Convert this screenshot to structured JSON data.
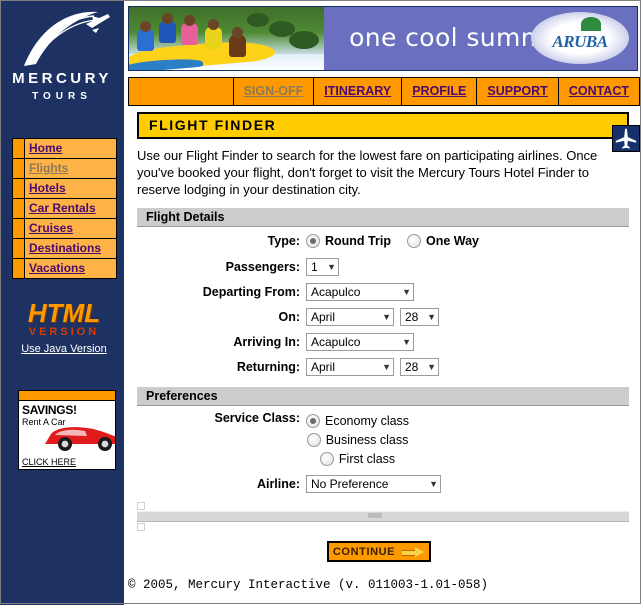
{
  "brand": {
    "name_line1": "MERCURY",
    "name_line2": "TOURS",
    "logo_icon": "airplane-swoosh-icon"
  },
  "banner": {
    "tagline": "one cool summer",
    "sponsor": "ARUBA",
    "photo_alt": "banana-boat-riders-photo"
  },
  "topnav": {
    "items": [
      {
        "label": "SIGN-OFF",
        "disabled": true
      },
      {
        "label": "ITINERARY",
        "disabled": false
      },
      {
        "label": "PROFILE",
        "disabled": false
      },
      {
        "label": "SUPPORT",
        "disabled": false
      },
      {
        "label": "CONTACT",
        "disabled": false
      }
    ]
  },
  "sidebar": {
    "items": [
      {
        "label": "Home",
        "disabled": false
      },
      {
        "label": "Flights",
        "disabled": true
      },
      {
        "label": "Hotels",
        "disabled": false
      },
      {
        "label": "Car Rentals",
        "disabled": false
      },
      {
        "label": "Cruises",
        "disabled": false
      },
      {
        "label": "Destinations",
        "disabled": false
      },
      {
        "label": "Vacations",
        "disabled": false
      }
    ],
    "html_version": {
      "line1": "HTML",
      "line2": "VERSION",
      "java_link": "Use Java Version"
    },
    "savings_ad": {
      "title": "SAVINGS!",
      "subtitle": "Rent A Car",
      "cta": "CLICK HERE"
    }
  },
  "main": {
    "title": "FLIGHT FINDER",
    "plane_icon": "airplane-icon",
    "intro": "Use our Flight Finder to search for the lowest fare on participating airlines. Once you've booked your flight, don't forget to visit the Mercury Tours Hotel Finder to reserve lodging in your destination city.",
    "flight_details": {
      "section_label": "Flight Details",
      "type_label": "Type:",
      "type_options": [
        {
          "label": "Round Trip",
          "selected": true
        },
        {
          "label": "One Way",
          "selected": false
        }
      ],
      "passengers_label": "Passengers:",
      "passengers_value": "1",
      "departing_label": "Departing From:",
      "departing_value": "Acapulco",
      "on_label": "On:",
      "on_month": "April",
      "on_day": "28",
      "arriving_label": "Arriving In:",
      "arriving_value": "Acapulco",
      "returning_label": "Returning:",
      "returning_month": "April",
      "returning_day": "28"
    },
    "preferences": {
      "section_label": "Preferences",
      "service_class_label": "Service Class:",
      "service_class_options": [
        {
          "label": "Economy class",
          "selected": true
        },
        {
          "label": "Business class",
          "selected": false
        },
        {
          "label": "First class",
          "selected": false
        }
      ],
      "airline_label": "Airline:",
      "airline_value": "No Preference"
    },
    "continue_label": "CONTINUE",
    "continue_icon": "arrow-right-icon"
  },
  "footer": {
    "text": "© 2005, Mercury Interactive (v. 011003-1.01-058)"
  },
  "colors": {
    "navy": "#1d3263",
    "orange": "#ff9900",
    "yellow": "#ffcc00",
    "link_purple": "#4b0a6e",
    "disabled": "#8a7a5a",
    "section_gray": "#cccccc"
  }
}
